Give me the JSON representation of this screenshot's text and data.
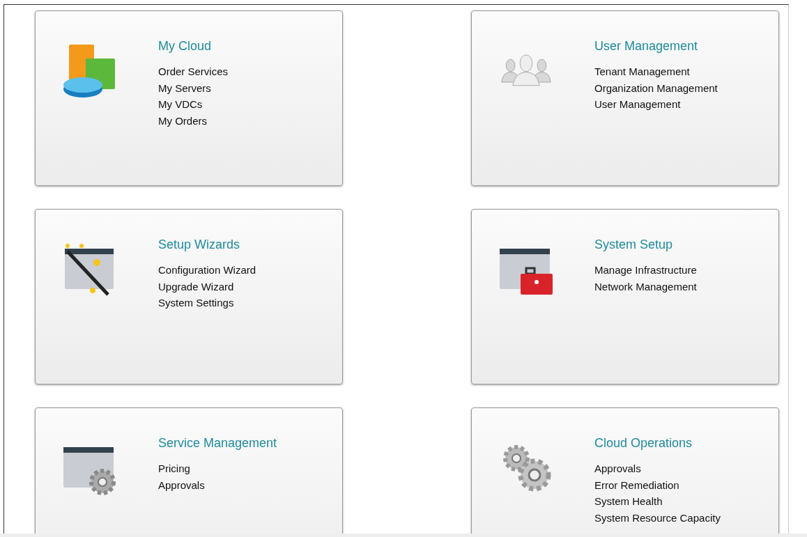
{
  "cards": [
    {
      "kind": "chart",
      "title": "My Cloud",
      "links": [
        "Order Services",
        "My Servers",
        "My VDCs",
        "My Orders"
      ]
    },
    {
      "kind": "users",
      "title": "User Management",
      "links": [
        "Tenant Management",
        "Organization Management",
        "User Management"
      ]
    },
    {
      "kind": "wand",
      "title": "Setup Wizards",
      "links": [
        "Configuration Wizard",
        "Upgrade Wizard",
        "System Settings"
      ]
    },
    {
      "kind": "toolbox",
      "title": "System Setup",
      "links": [
        "Manage Infrastructure",
        "Network Management"
      ]
    },
    {
      "kind": "window-gear",
      "title": "Service Management",
      "links": [
        "Pricing",
        "Approvals"
      ]
    },
    {
      "kind": "gears",
      "title": "Cloud Operations",
      "links": [
        "Approvals",
        "Error Remediation",
        "System Health",
        "System Resource Capacity"
      ]
    }
  ]
}
